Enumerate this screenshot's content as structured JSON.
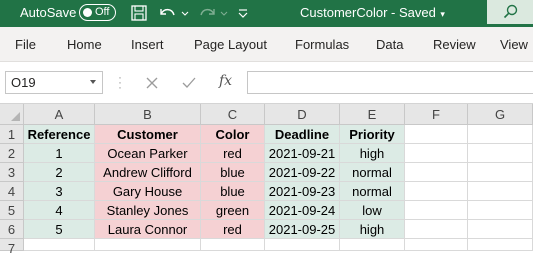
{
  "titlebar": {
    "autosave_label": "AutoSave",
    "autosave_state": "Off",
    "document_title": "CustomerColor - Saved",
    "background_color": "#217346",
    "icons": [
      "save-icon",
      "undo-icon",
      "undo-dropdown-icon",
      "redo-icon",
      "redo-dropdown-icon",
      "qat-customize-icon",
      "title-dropdown-icon",
      "search-icon"
    ]
  },
  "ribbon": {
    "tabs": [
      "File",
      "Home",
      "Insert",
      "Page Layout",
      "Formulas",
      "Data",
      "Review",
      "View"
    ]
  },
  "formula_bar": {
    "name_box": "O19",
    "formula": "",
    "icons": [
      "cancel-icon",
      "enter-icon",
      "insert-function-icon"
    ]
  },
  "sheet": {
    "columns": [
      "A",
      "B",
      "C",
      "D",
      "E",
      "F",
      "G"
    ],
    "row_numbers": [
      "1",
      "2",
      "3",
      "4",
      "5",
      "6",
      "7"
    ],
    "header": [
      "Reference",
      "Customer",
      "Color",
      "Deadline",
      "Priority"
    ],
    "rows": [
      [
        "1",
        "Ocean Parker",
        "red",
        "2021-09-21",
        "high"
      ],
      [
        "2",
        "Andrew Clifford",
        "blue",
        "2021-09-22",
        "normal"
      ],
      [
        "3",
        "Gary House",
        "blue",
        "2021-09-23",
        "normal"
      ],
      [
        "4",
        "Stanley Jones",
        "green",
        "2021-09-24",
        "low"
      ],
      [
        "5",
        "Laura Connor",
        "red",
        "2021-09-25",
        "high"
      ]
    ],
    "fill_colors": {
      "reference": "#dcebe5",
      "customer": "#f5d1d3",
      "color": "#f5d1d3",
      "deadline": "#dcebe5",
      "priority": "#dcebe5"
    }
  }
}
